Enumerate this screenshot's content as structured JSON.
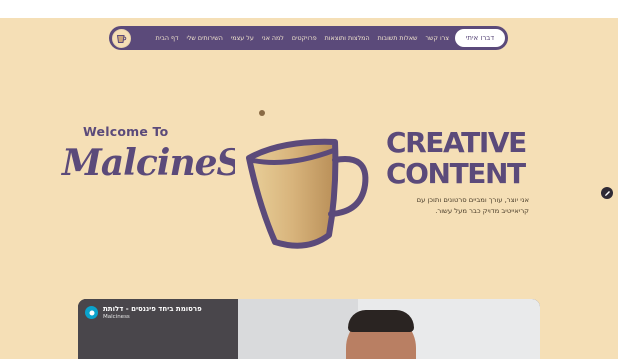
{
  "nav": {
    "contact_button": "דברו איתי",
    "items": [
      "צרו קשר",
      "שאלות תשובות",
      "המלצות ותוצאות",
      "פרויקטים",
      "למה אני",
      "על עצמי",
      "השירותים שלי",
      "דף הבית"
    ]
  },
  "hero": {
    "welcome": "Welcome To",
    "brand": "MalcineSS",
    "headline_line1": "CREATIVE",
    "headline_line2": "CONTENT",
    "tagline_line1": "אני יוצר, עורך ומביים סרטונים ותוכן עם",
    "tagline_line2": "קריאייטיב מדויק כבר מעל עשור."
  },
  "video": {
    "title": "פרסומת ביחד פיננסים - דלותת",
    "channel": "Malciness"
  },
  "colors": {
    "background": "#f5dfb6",
    "brand_purple": "#5b4a7a",
    "nav_text": "#f3e6cf"
  }
}
